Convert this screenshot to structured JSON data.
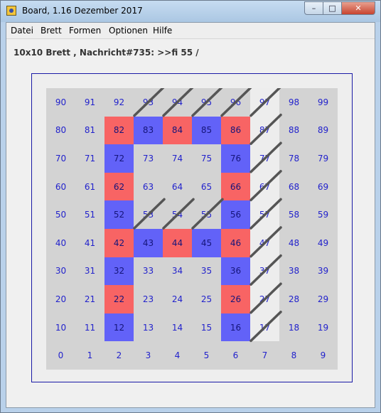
{
  "window": {
    "title": "Board, 1.16 Dezember 2017",
    "minimize": "–",
    "maximize": "□",
    "close": "✕"
  },
  "menu": [
    "Datei",
    "Brett",
    "Formen",
    "Optionen",
    "Hilfe"
  ],
  "status": "10x10 Brett , Nachricht#735: >>fi 55 /",
  "board": {
    "size": 10,
    "colors": {
      "background": "#d3d3d3",
      "blue": "#6262f8",
      "red": "#f86464",
      "light": "#ededed",
      "number": "#2222cc"
    },
    "blue_cells": [
      12,
      16,
      32,
      36,
      43,
      45,
      52,
      56,
      72,
      76,
      83,
      85
    ],
    "red_cells": [
      22,
      26,
      42,
      44,
      46,
      62,
      66,
      82,
      84,
      86
    ],
    "light_cells": [
      17,
      27,
      37,
      47,
      57,
      67,
      77,
      87,
      97
    ],
    "diagonal_cells": [
      17,
      27,
      37,
      47,
      57,
      67,
      77,
      87,
      97,
      53,
      54,
      55,
      93,
      94,
      95,
      96
    ]
  }
}
